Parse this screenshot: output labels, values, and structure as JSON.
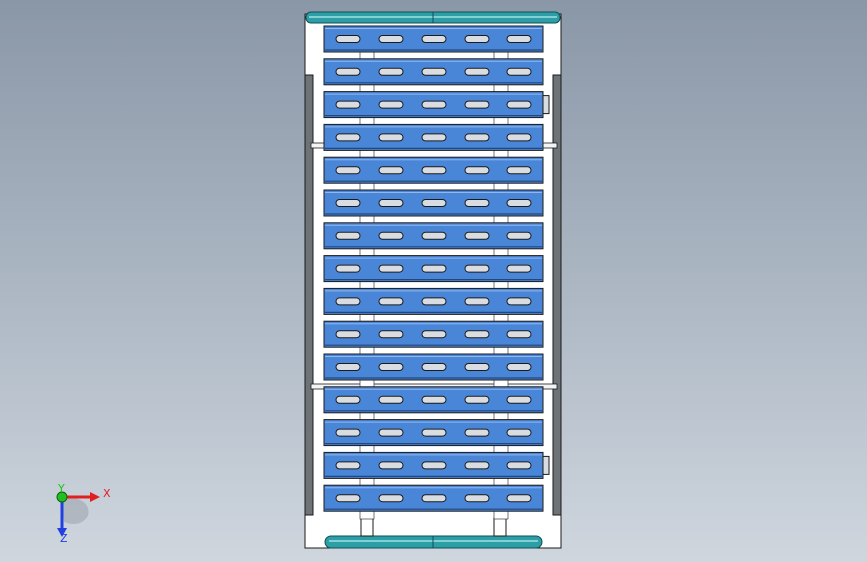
{
  "scene": {
    "view": "Front",
    "object": "rack-with-tray-shelves",
    "tray_count": 15,
    "slots_per_tray": 5,
    "colors": {
      "background_top": "#8a97a7",
      "background_bottom": "#cfd6de",
      "tray_blue": "#4a86d8",
      "tray_edge": "#23477a",
      "frame_white": "#ffffff",
      "post_gray": "#6e7378",
      "bar_teal": "#2e9ea6",
      "slot_fill": "#d9dde2",
      "edge_line": "#1b1b1b"
    }
  },
  "triad": {
    "x_label": "X",
    "y_label": "Y",
    "z_label": "Z",
    "x_color": "#e02020",
    "y_color": "#20c020",
    "z_color": "#2040e0"
  }
}
